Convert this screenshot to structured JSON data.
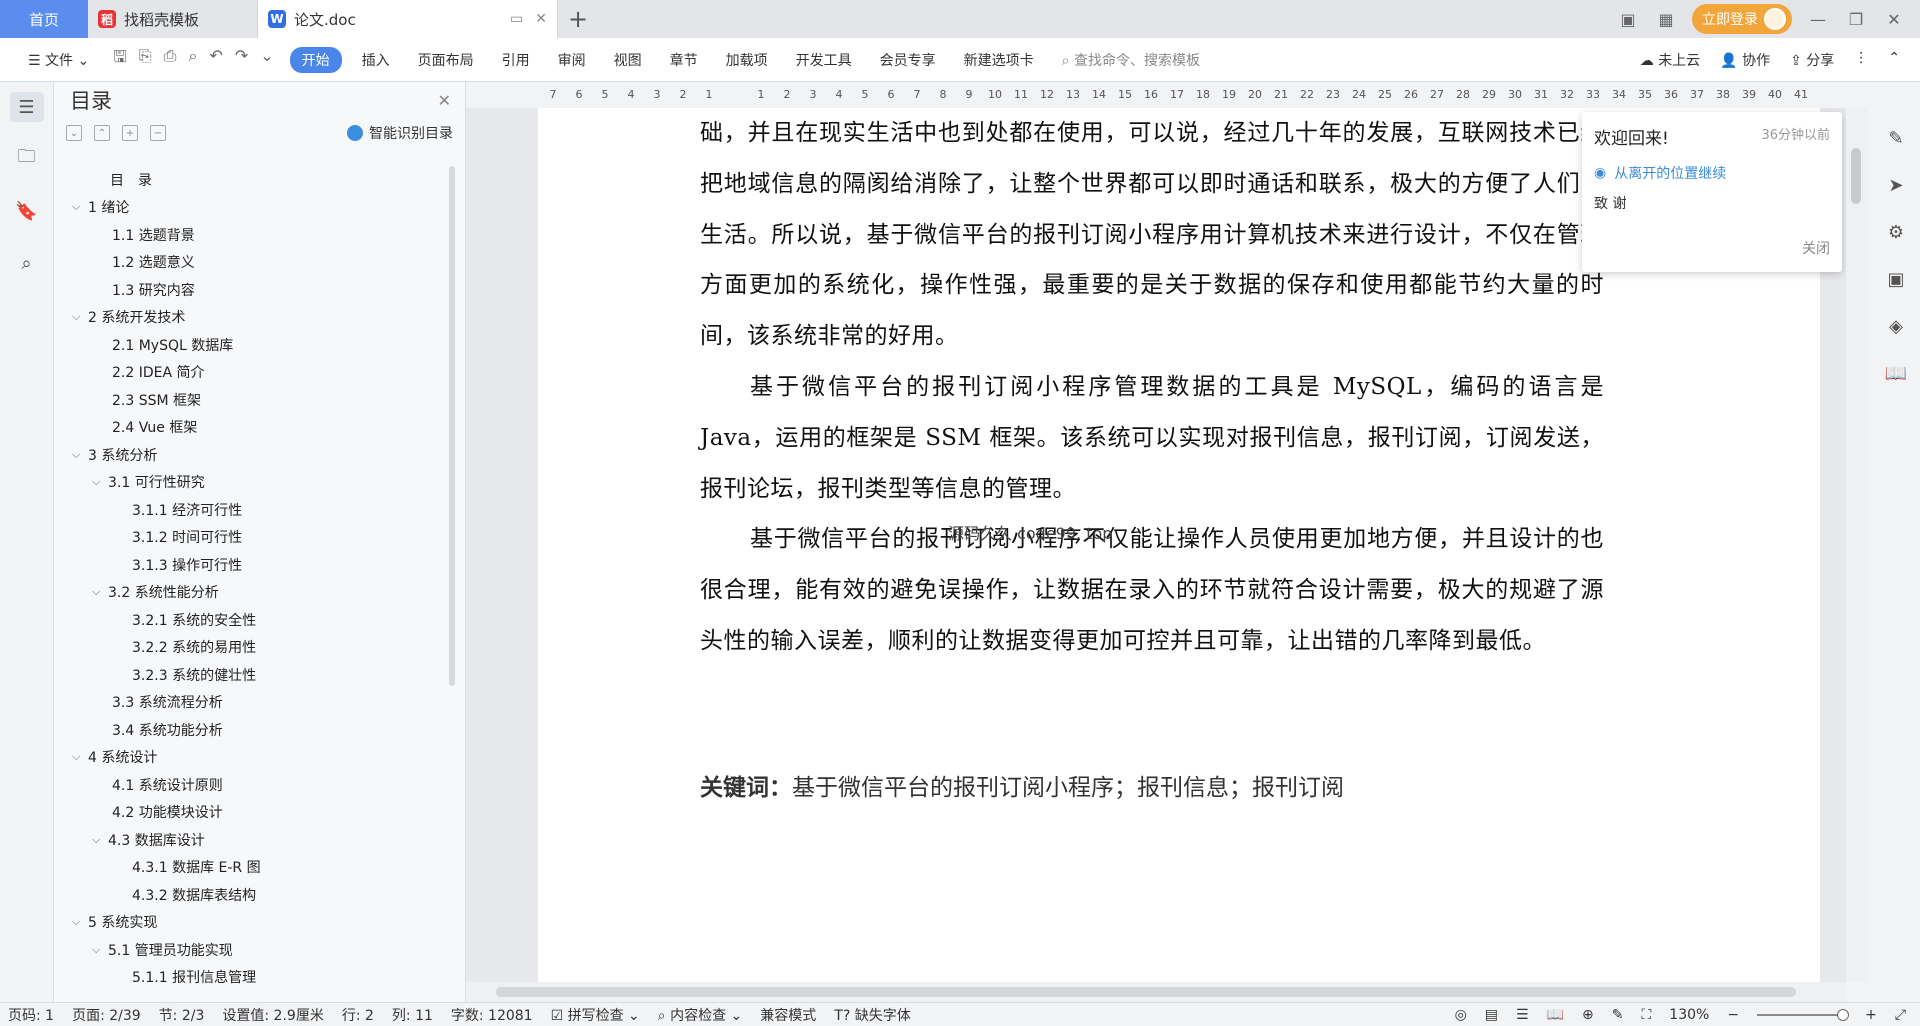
{
  "tabs": {
    "home": "首页",
    "template": "找稻壳模板",
    "doc": "论文.doc"
  },
  "titlebar": {
    "login": "立即登录"
  },
  "ribbon": {
    "file": "文件",
    "items": [
      "开始",
      "插入",
      "页面布局",
      "引用",
      "审阅",
      "视图",
      "章节",
      "加载项",
      "开发工具",
      "会员专享",
      "新建选项卡"
    ],
    "search": "查找命令、搜索模板",
    "cloud": "未上云",
    "collab": "协作",
    "share": "分享"
  },
  "toc": {
    "title": "目录",
    "ai_label": "智能识别目录",
    "items": [
      {
        "level": 0,
        "arrow": "",
        "text": "目　录"
      },
      {
        "level": 0,
        "arrow": "v",
        "text": "1  绪论"
      },
      {
        "level": 1,
        "arrow": "",
        "text": "1.1  选题背景"
      },
      {
        "level": 1,
        "arrow": "",
        "text": "1.2  选题意义"
      },
      {
        "level": 1,
        "arrow": "",
        "text": "1.3  研究内容"
      },
      {
        "level": 0,
        "arrow": "v",
        "text": "2  系统开发技术"
      },
      {
        "level": 1,
        "arrow": "",
        "text": "2.1 MySQL 数据库"
      },
      {
        "level": 1,
        "arrow": "",
        "text": "2.2 IDEA 简介"
      },
      {
        "level": 1,
        "arrow": "",
        "text": "2.3 SSM 框架"
      },
      {
        "level": 1,
        "arrow": "",
        "text": "2.4 Vue 框架"
      },
      {
        "level": 0,
        "arrow": "v",
        "text": "3  系统分析"
      },
      {
        "level": 1,
        "arrow": "v",
        "text": "3.1  可行性研究"
      },
      {
        "level": 2,
        "arrow": "",
        "text": "3.1.1  经济可行性"
      },
      {
        "level": 2,
        "arrow": "",
        "text": "3.1.2  时间可行性"
      },
      {
        "level": 2,
        "arrow": "",
        "text": "3.1.3  操作可行性"
      },
      {
        "level": 1,
        "arrow": "v",
        "text": "3.2  系统性能分析"
      },
      {
        "level": 2,
        "arrow": "",
        "text": "3.2.1  系统的安全性"
      },
      {
        "level": 2,
        "arrow": "",
        "text": "3.2.2  系统的易用性"
      },
      {
        "level": 2,
        "arrow": "",
        "text": "3.2.3  系统的健壮性"
      },
      {
        "level": 1,
        "arrow": "",
        "text": "3.3  系统流程分析"
      },
      {
        "level": 1,
        "arrow": "",
        "text": "3.4  系统功能分析"
      },
      {
        "level": 0,
        "arrow": "v",
        "text": "4  系统设计"
      },
      {
        "level": 1,
        "arrow": "",
        "text": "4.1  系统设计原则"
      },
      {
        "level": 1,
        "arrow": "",
        "text": "4.2  功能模块设计"
      },
      {
        "level": 1,
        "arrow": "v",
        "text": "4.3  数据库设计"
      },
      {
        "level": 2,
        "arrow": "",
        "text": "4.3.1  数据库 E-R 图"
      },
      {
        "level": 2,
        "arrow": "",
        "text": "4.3.2  数据库表结构"
      },
      {
        "level": 0,
        "arrow": "v",
        "text": "5  系统实现"
      },
      {
        "level": 1,
        "arrow": "v",
        "text": "5.1  管理员功能实现"
      },
      {
        "level": 2,
        "arrow": "",
        "text": "5.1.1  报刊信息管理"
      }
    ]
  },
  "ruler": [
    "7",
    "6",
    "5",
    "4",
    "3",
    "2",
    "1",
    "",
    "1",
    "2",
    "3",
    "4",
    "5",
    "6",
    "7",
    "8",
    "9",
    "10",
    "11",
    "12",
    "13",
    "14",
    "15",
    "16",
    "17",
    "18",
    "19",
    "20",
    "21",
    "22",
    "23",
    "24",
    "25",
    "26",
    "27",
    "28",
    "29",
    "30",
    "31",
    "32",
    "33",
    "34",
    "35",
    "36",
    "37",
    "38",
    "39",
    "40",
    "41"
  ],
  "doc": {
    "p1": "础，并且在现实生活中也到处都在使用，可以说，经过几十年的发展，互联网技术已经把地域信息的隔阂给消除了，让整个世界都可以即时通话和联系，极大的方便了人们的生活。所以说，基于微信平台的报刊订阅小程序用计算机技术来进行设计，不仅在管理方面更加的系统化，操作性强，最重要的是关于数据的保存和使用都能节约大量的时间，该系统非常的好用。",
    "p2": "基于微信平台的报刊订阅小程序管理数据的工具是 MySQL，编码的语言是 Java，运用的框架是 SSM 框架。该系统可以实现对报刊信息，报刊订阅，订阅发送，报刊论坛，报刊类型等信息的管理。",
    "p3": "基于微信平台的报刊订阅小程序不仅能让操作人员使用更加地方便，并且设计的也很合理，能有效的避免误操作，让数据在录入的环节就符合设计需要，极大的规避了源头性的输入误差，顺利的让数据变得更加可控并且可靠，让出错的几率降到最低。",
    "watermark": "源码久久 code99. top",
    "kw_label": "关键词：",
    "kw_text": "基于微信平台的报刊订阅小程序；报刊信息；报刊订阅"
  },
  "popup": {
    "title": "欢迎回来!",
    "time": "36分钟以前",
    "link": "从离开的位置继续",
    "section": "致  谢",
    "close": "关闭"
  },
  "status": {
    "page_code": "页码: 1",
    "page": "页面: 2/39",
    "section": "节: 2/3",
    "setting": "设置值: 2.9厘米",
    "row": "行: 2",
    "col": "列: 11",
    "words": "字数: 12081",
    "spell": "拼写检查",
    "content": "内容检查",
    "compat": "兼容模式",
    "font": "缺失字体",
    "zoom": "130%"
  }
}
